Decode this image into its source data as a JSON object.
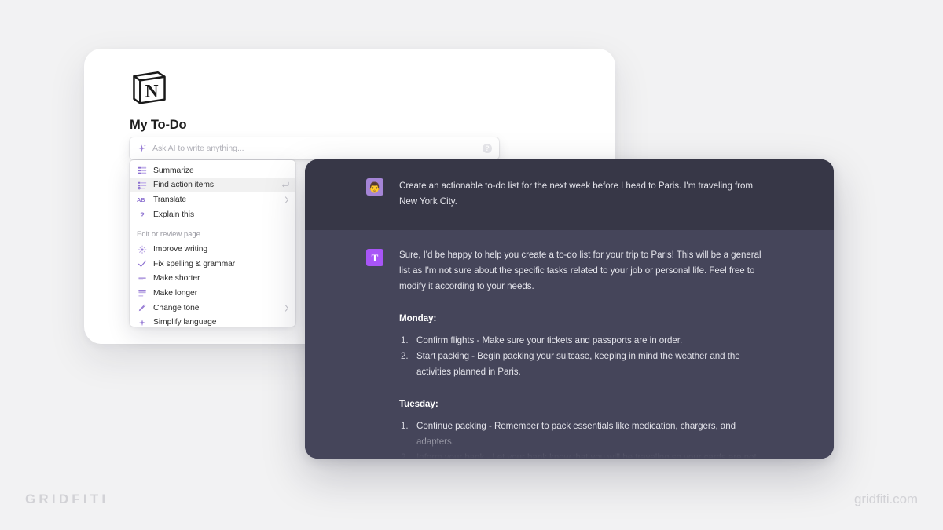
{
  "page": {
    "background_color": "#f2f2f3",
    "brand_left": "GRIDFITI",
    "brand_right": "gridfiti.com"
  },
  "notion_card": {
    "logo_icon": "notion-logo-icon",
    "title": "My To-Do",
    "ai_bar": {
      "leading_icon": "sparkle-icon",
      "placeholder": "Ask AI to write anything...",
      "value": "",
      "trailing_icon": "help-circle-icon",
      "trailing_glyph": "?"
    }
  },
  "ai_menu": {
    "groups": [
      {
        "section_label": null,
        "items": [
          {
            "label": "Summarize",
            "icon": "summarize-list-icon",
            "active": false,
            "trailing": null
          },
          {
            "label": "Find action items",
            "icon": "checklist-icon",
            "active": true,
            "trailing": "enter-return-icon"
          },
          {
            "label": "Translate",
            "icon": "ab-translate-icon",
            "active": false,
            "trailing": "chevron-right-icon"
          },
          {
            "label": "Explain this",
            "icon": "question-mark-icon",
            "active": false,
            "trailing": null
          }
        ]
      },
      {
        "section_label": "Edit or review page",
        "items": [
          {
            "label": "Improve writing",
            "icon": "sparkle-burst-icon",
            "active": false,
            "trailing": null
          },
          {
            "label": "Fix spelling & grammar",
            "icon": "checkmark-icon",
            "active": false,
            "trailing": null
          },
          {
            "label": "Make shorter",
            "icon": "short-line-icon",
            "active": false,
            "trailing": null
          },
          {
            "label": "Make longer",
            "icon": "long-lines-icon",
            "active": false,
            "trailing": null
          },
          {
            "label": "Change tone",
            "icon": "pen-icon",
            "active": false,
            "trailing": "chevron-right-icon"
          },
          {
            "label": "Simplify language",
            "icon": "sparkle-small-icon",
            "active": false,
            "trailing": null
          }
        ]
      }
    ]
  },
  "chat": {
    "accent_color": "#a855f7",
    "panel_color": "#3d3d4e",
    "user_message": {
      "avatar_icon": "user-face-avatar",
      "avatar_glyph": "👨",
      "text": "Create an actionable to-do list for the next week before I head to Paris. I'm traveling from New York City."
    },
    "ai_message": {
      "avatar_icon": "ai-assistant-avatar",
      "avatar_glyph": "T",
      "intro": "Sure, I'd be happy to help you create a to-do list for your trip to Paris! This will be a general list as I'm not sure about the specific tasks related to your job or personal life. Feel free to modify it according to your needs.",
      "days": [
        {
          "heading": "Monday:",
          "tasks": [
            "Confirm flights - Make sure your tickets and passports are in order.",
            "Start packing - Begin packing your suitcase, keeping in mind the weather and the activities planned in Paris."
          ]
        },
        {
          "heading": "Tuesday:",
          "tasks": [
            "Continue packing - Remember to pack essentials like medication, chargers, and adapters.",
            "Inform your bank - Let your bank know that you will be traveling so your cards are not"
          ]
        }
      ]
    }
  }
}
